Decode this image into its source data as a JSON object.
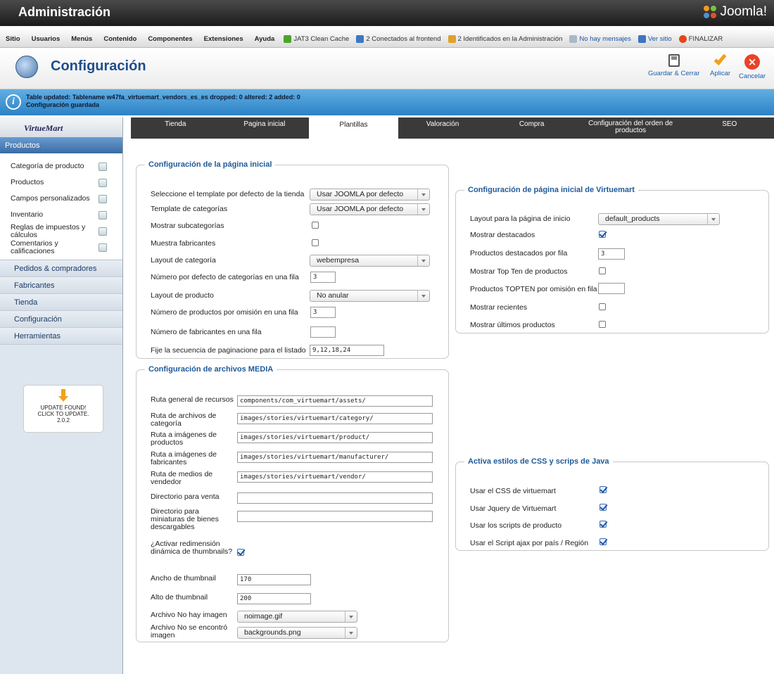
{
  "app": {
    "title": "Administración",
    "logo_text": "Joomla!"
  },
  "menu": {
    "items": [
      "Sitio",
      "Usuarios",
      "Menús",
      "Contenido",
      "Componentes",
      "Extensiones",
      "Ayuda"
    ],
    "status": [
      {
        "text": "JAT3 Clean Cache",
        "color": "#4aa32f",
        "icon": "broom-icon"
      },
      {
        "text": "2 Conectados al frontend",
        "color": "#3b78c4",
        "icon": "users-icon"
      },
      {
        "text": "2 Identificados en la Administración",
        "color": "#e0a12b",
        "icon": "admin-users-icon"
      },
      {
        "text": "No hay mensajes",
        "color": "#aab8c6",
        "icon": "message-icon"
      },
      {
        "text": "Ver sitio",
        "color": "#3f73c2",
        "icon": "monitor-icon"
      },
      {
        "text": "FINALIZAR",
        "color": "#e2471b",
        "icon": "power-icon"
      }
    ]
  },
  "header": {
    "title": "Configuración"
  },
  "toolbar": {
    "save_close": "Guardar & Cerrar",
    "apply": "Aplicar",
    "cancel": "Cancelar"
  },
  "message": {
    "line1": "Table updated: Tablename w47fa_virtuemart_vendors_es_es dropped: 0 altered: 2 added: 0",
    "line2": "Configuración guardada"
  },
  "sidebar": {
    "logo": "VirtueMart",
    "section": "Productos",
    "items": [
      "Categoría de producto",
      "Productos",
      "Campos personalizados",
      "Inventario",
      "Reglas de impuestos y cálculos",
      "Comentarios y calificaciones"
    ],
    "groups": [
      "Pedidos & compradores",
      "Fabricantes",
      "Tienda",
      "Configuración",
      "Herramientas"
    ],
    "update": {
      "line1": "UPDATE FOUND!",
      "line2": "CLICK TO UPDATE.",
      "version": "2.0.2"
    }
  },
  "tabs": [
    "Tienda",
    "Pagina inicial",
    "Plantillas",
    "Valoración",
    "Compra",
    "Configuración del orden de productos",
    "SEO"
  ],
  "active_tab": "Plantillas",
  "home": {
    "legend": "Configuración de la página inicial",
    "rows": [
      {
        "label": "Seleccione el template por defecto de la tienda",
        "value": "Usar JOOMLA por defecto"
      },
      {
        "label": "Template de categorías",
        "value": "Usar JOOMLA por defecto"
      },
      {
        "label": "Mostrar subcategorías",
        "checked": false
      },
      {
        "label": "Muestra fabricantes",
        "checked": false
      },
      {
        "label": "Layout de categoría",
        "value": "webempresa"
      },
      {
        "label": "Número por defecto de categorías en una fila",
        "value": "3"
      },
      {
        "label": "Layout de producto",
        "value": "No anular"
      },
      {
        "label": "Número de productos por omisión en una fila",
        "value": "3"
      },
      {
        "label": "Número de fabricantes en una fila",
        "value": ""
      },
      {
        "label": "Fije la secuencia de paginacione para el listado",
        "value": "9,12,18,24"
      }
    ]
  },
  "media": {
    "legend": "Configuración de archivos MEDIA",
    "rows": [
      {
        "label": "Ruta general de recursos",
        "value": "components/com_virtuemart/assets/"
      },
      {
        "label": "Ruta de archivos de categoría",
        "value": "images/stories/virtuemart/category/"
      },
      {
        "label": "Ruta a imágenes de productos",
        "value": "images/stories/virtuemart/product/"
      },
      {
        "label": "Ruta a imágenes de fabricantes",
        "value": "images/stories/virtuemart/manufacturer/"
      },
      {
        "label": "Ruta de medios de vendedor",
        "value": "images/stories/virtuemart/vendor/"
      },
      {
        "label": "Directorio para venta",
        "value": ""
      },
      {
        "label": "Directorio para miniaturas de bienes descargables",
        "value": ""
      },
      {
        "label": "¿Activar redimensión dinámica de thumbnails?",
        "checked": true
      },
      {
        "label": "Ancho de thumbnail",
        "value": "170"
      },
      {
        "label": "Alto de thumbnail",
        "value": "200"
      },
      {
        "label": "Archivo No hay imagen",
        "value": "noimage.gif"
      },
      {
        "label": "Archivo No se encontró imagen",
        "value": "backgrounds.png"
      }
    ]
  },
  "vmhome": {
    "legend": "Configuración de página inicial de Virtuemart",
    "rows": [
      {
        "label": "Layout para la página de inicio",
        "value": "default_products"
      },
      {
        "label": "Mostrar destacados",
        "checked": true
      },
      {
        "label": "Productos destacados por fila",
        "value": "3"
      },
      {
        "label": "Mostrar Top Ten de productos",
        "checked": false
      },
      {
        "label": "Productos TOPTEN por omisión en fila",
        "value": ""
      },
      {
        "label": "Mostrar recientes",
        "checked": false
      },
      {
        "label": "Mostrar últimos productos",
        "checked": false
      }
    ]
  },
  "css": {
    "legend": "Activa estilos de CSS y scrips de Java",
    "rows": [
      {
        "label": "Usar el CSS de virtuemart",
        "checked": true
      },
      {
        "label": "Usar Jquery de Virtuemart",
        "checked": true
      },
      {
        "label": "Usar los scripts de producto",
        "checked": true
      },
      {
        "label": "Usar el Script ajax por país / Región",
        "checked": true
      }
    ]
  }
}
